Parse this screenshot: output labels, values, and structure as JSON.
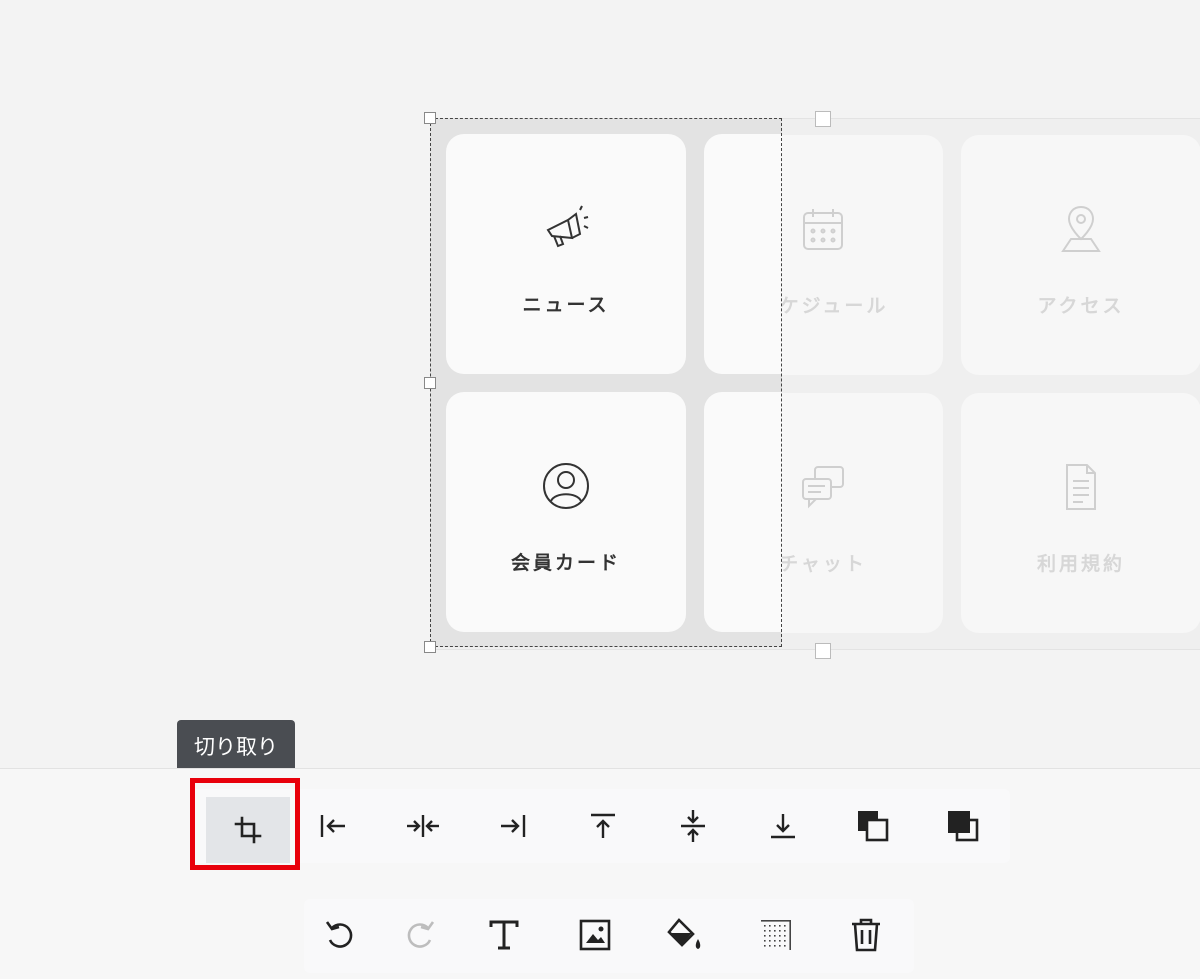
{
  "tiles": [
    {
      "label": "ニュース",
      "icon": "megaphone-icon",
      "faded": false
    },
    {
      "label": "スケジュール",
      "icon": "calendar-icon",
      "faded": true
    },
    {
      "label": "アクセス",
      "icon": "map-pin-icon",
      "faded": true
    },
    {
      "label": "会員カード",
      "icon": "user-circle-icon",
      "faded": false
    },
    {
      "label": "チャット",
      "icon": "chat-bubbles-icon",
      "faded": true
    },
    {
      "label": "利用規約",
      "icon": "document-icon",
      "faded": true
    }
  ],
  "tooltip": {
    "text": "切り取り"
  },
  "toolbar_primary": [
    {
      "name": "crop-icon",
      "active": true
    },
    {
      "name": "align-left-icon"
    },
    {
      "name": "align-center-horizontal-icon"
    },
    {
      "name": "align-right-icon"
    },
    {
      "name": "align-top-icon"
    },
    {
      "name": "align-middle-vertical-icon"
    },
    {
      "name": "align-bottom-icon"
    },
    {
      "name": "send-backward-icon"
    },
    {
      "name": "bring-forward-icon"
    }
  ],
  "toolbar_secondary": [
    {
      "name": "undo-icon"
    },
    {
      "name": "redo-icon",
      "disabled": true
    },
    {
      "name": "text-icon"
    },
    {
      "name": "image-icon"
    },
    {
      "name": "fill-color-icon"
    },
    {
      "name": "transparency-icon"
    },
    {
      "name": "delete-icon"
    }
  ],
  "colors": {
    "highlight": "#e8000b",
    "tooltip_bg": "#4a4d52",
    "active_button": "#e3e5e8"
  }
}
